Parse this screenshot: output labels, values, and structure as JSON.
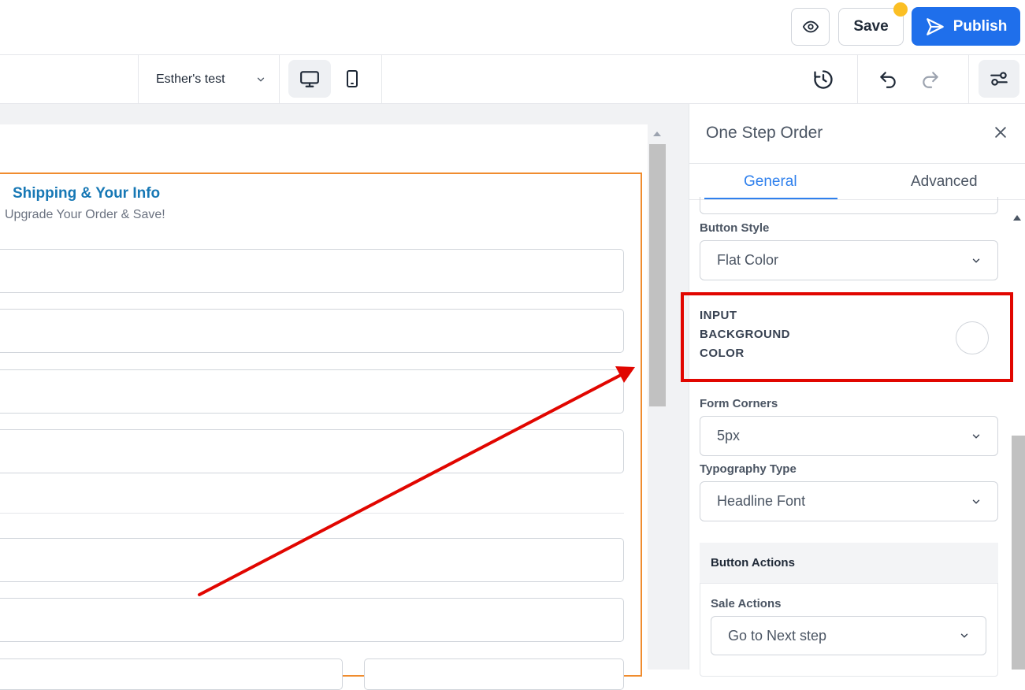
{
  "header": {
    "save_label": "Save",
    "publish_label": "Publish",
    "preview_icon": "eye-icon",
    "publish_icon": "send-icon",
    "accent_color": "#1f6feb",
    "notification_color": "#fbbf24"
  },
  "toolbar": {
    "page_name": "Esther's test",
    "devices": [
      "desktop-icon",
      "mobile-icon"
    ],
    "icons": [
      "history-icon",
      "undo-icon",
      "redo-icon",
      "settings-sliders-icon"
    ]
  },
  "canvas": {
    "form_title": "Shipping & Your Info",
    "form_subtitle": "Upgrade Your Order & Save!",
    "title_color": "#1778b5",
    "selection_color": "#f08c2e"
  },
  "panel": {
    "title": "One Step Order",
    "tabs": [
      {
        "label": "General",
        "active": true
      },
      {
        "label": "Advanced",
        "active": false
      }
    ],
    "button_style": {
      "label": "Button Style",
      "value": "Flat Color"
    },
    "input_background": {
      "label_line1": "INPUT",
      "label_line2": "BACKGROUND",
      "label_line3": "COLOR",
      "value": "#ffffff"
    },
    "form_corners": {
      "label": "Form Corners",
      "value": "5px"
    },
    "typography": {
      "label": "Typography Type",
      "value": "Headline Font"
    },
    "button_actions": {
      "title": "Button Actions",
      "sale_actions": {
        "label": "Sale Actions",
        "value": "Go to Next step"
      }
    }
  },
  "annotation": {
    "highlight_color": "#e10600"
  }
}
